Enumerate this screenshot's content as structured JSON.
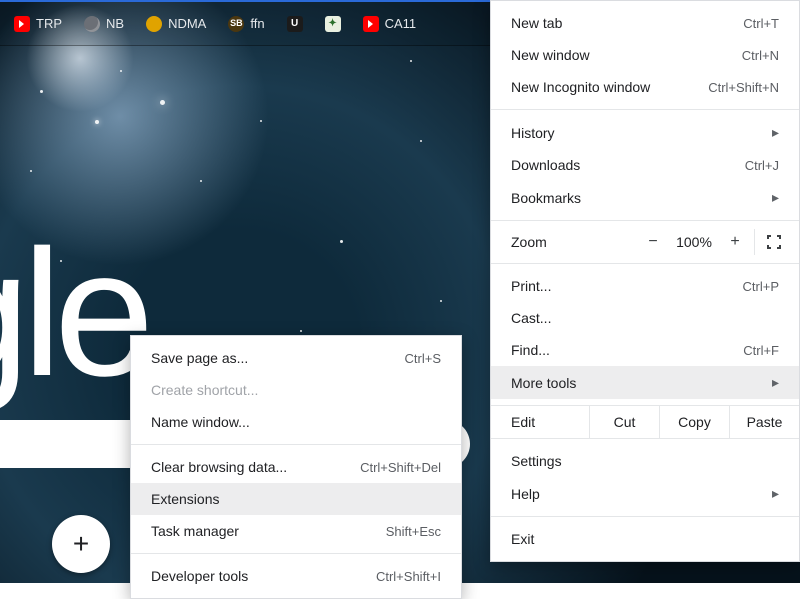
{
  "bookmarks": [
    {
      "label": "TRP",
      "icon": "yt"
    },
    {
      "label": "NB",
      "icon": "globe"
    },
    {
      "label": "NDMA",
      "icon": "nd"
    },
    {
      "label": "ffn",
      "icon": "sb"
    },
    {
      "label": "",
      "icon": "u",
      "iconText": "U"
    },
    {
      "label": "",
      "icon": "g"
    },
    {
      "label": "CA11",
      "icon": "yt"
    }
  ],
  "bg_text": "gle",
  "fab_glyph": "+",
  "menu": {
    "new_tab": {
      "label": "New tab",
      "shortcut": "Ctrl+T"
    },
    "new_window": {
      "label": "New window",
      "shortcut": "Ctrl+N"
    },
    "new_incognito": {
      "label": "New Incognito window",
      "shortcut": "Ctrl+Shift+N"
    },
    "history": {
      "label": "History"
    },
    "downloads": {
      "label": "Downloads",
      "shortcut": "Ctrl+J"
    },
    "bookmarks": {
      "label": "Bookmarks"
    },
    "zoom": {
      "label": "Zoom",
      "minus": "−",
      "value": "100%",
      "plus": "+"
    },
    "print": {
      "label": "Print...",
      "shortcut": "Ctrl+P"
    },
    "cast": {
      "label": "Cast..."
    },
    "find": {
      "label": "Find...",
      "shortcut": "Ctrl+F"
    },
    "more_tools": {
      "label": "More tools"
    },
    "edit": {
      "label": "Edit",
      "cut": "Cut",
      "copy": "Copy",
      "paste": "Paste"
    },
    "settings": {
      "label": "Settings"
    },
    "help": {
      "label": "Help"
    },
    "exit": {
      "label": "Exit"
    }
  },
  "submenu": {
    "save_page": {
      "label": "Save page as...",
      "shortcut": "Ctrl+S"
    },
    "create_shortcut": {
      "label": "Create shortcut..."
    },
    "name_window": {
      "label": "Name window..."
    },
    "clear_data": {
      "label": "Clear browsing data...",
      "shortcut": "Ctrl+Shift+Del"
    },
    "extensions": {
      "label": "Extensions"
    },
    "task_manager": {
      "label": "Task manager",
      "shortcut": "Shift+Esc"
    },
    "dev_tools": {
      "label": "Developer tools",
      "shortcut": "Ctrl+Shift+I"
    }
  }
}
